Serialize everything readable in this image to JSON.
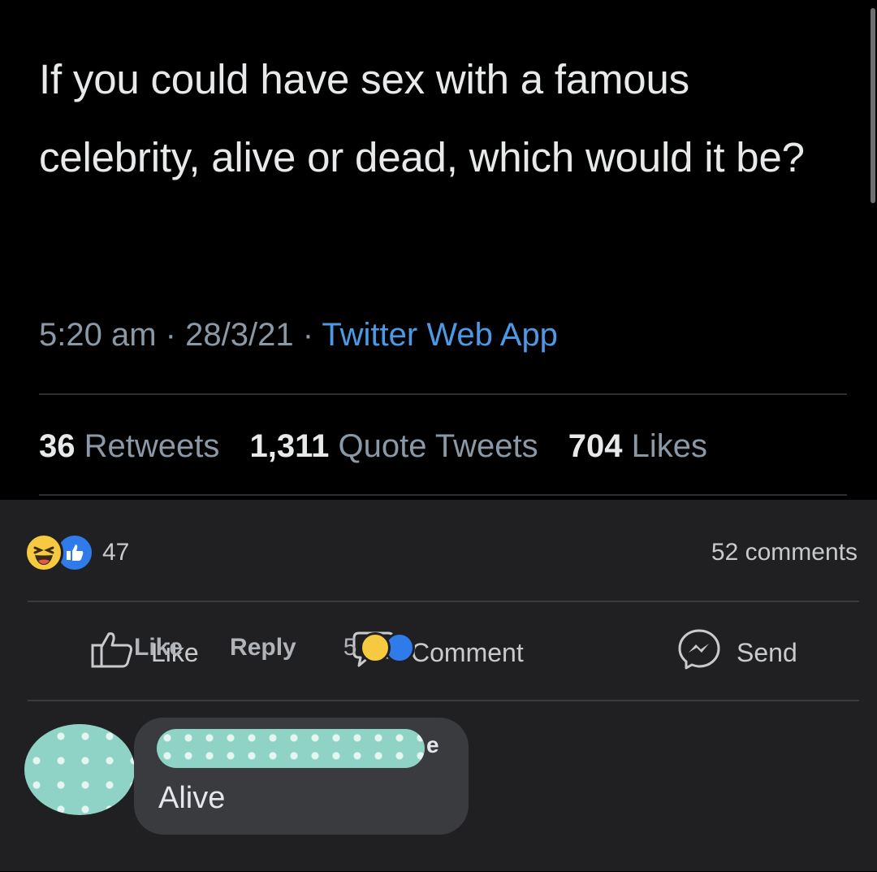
{
  "tweet": {
    "text": "If you could have sex with a famous celebrity, alive or dead, which would it be?",
    "time": "5:20 am",
    "date": "28/3/21",
    "separator": "·",
    "source": "Twitter Web App",
    "stats": {
      "retweets_count": "36",
      "retweets_label": "Retweets",
      "quotes_count": "1,311",
      "quotes_label": "Quote Tweets",
      "likes_count": "704",
      "likes_label": "Likes"
    }
  },
  "facebook": {
    "reactions": {
      "icons": [
        "haha-icon",
        "like-icon"
      ],
      "count": "47"
    },
    "comments_count": "52 comments",
    "actions": {
      "like": "Like",
      "comment": "Comment",
      "send": "Send"
    },
    "comment": {
      "name_suffix": "e",
      "text": "Alive",
      "like_label": "Like",
      "reply_label": "Reply",
      "reaction_count": "5",
      "reaction_icons": [
        "haha-icon",
        "like-icon"
      ]
    },
    "colors": {
      "background": "#202023",
      "tweet_background": "#000000",
      "link_blue": "#4c9ae6",
      "haha_yellow": "#f7c940",
      "like_blue": "#2f7bea"
    }
  }
}
